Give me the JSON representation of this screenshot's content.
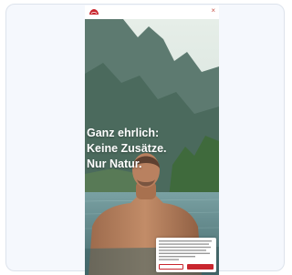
{
  "page": {
    "close_symbol": "×"
  },
  "hero": {
    "headline": [
      "Ganz ehrlich:",
      "Keine Zusätze.",
      "Nur Natur."
    ]
  },
  "cookie_banner": {
    "text": "",
    "settings_label": "",
    "accept_label": ""
  },
  "colors": {
    "accent": "#c9262e",
    "frame_background": "#f5f8fd",
    "frame_border": "#dde3ec"
  },
  "icons": {
    "logo": "brand-logo",
    "close": "close-icon"
  }
}
